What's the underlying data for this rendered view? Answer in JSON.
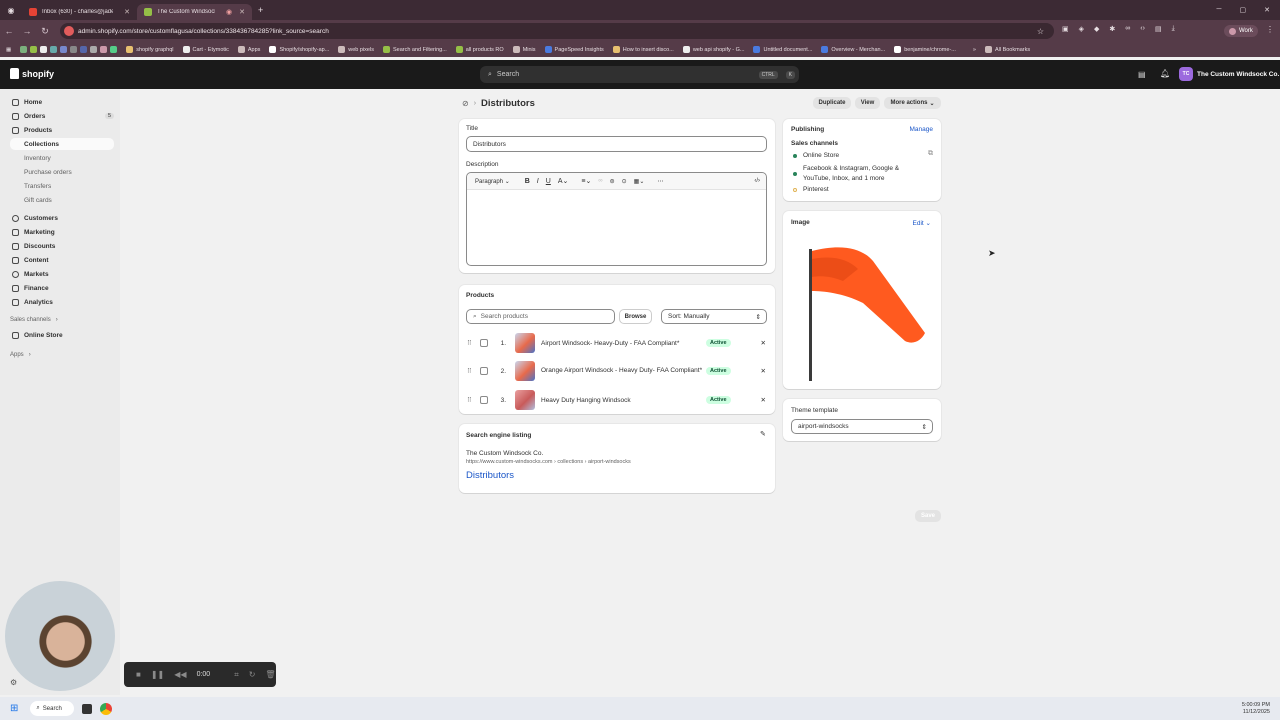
{
  "browser": {
    "tabs": [
      {
        "title": "Inbox (630) - charles@jadepur…",
        "active": false
      },
      {
        "title": "The Custom Windsock Co.",
        "active": true
      }
    ],
    "url": "admin.shopify.com/store/customflagusa/collections/338436784285?link_source=search",
    "profile": "Work",
    "bookmarks": [
      "shopify graphql",
      "Cart - Etymotic",
      "Apps",
      "Shopify/shopify-ap...",
      "web pixels",
      "Search and Filtering...",
      "all products RO",
      "Minis",
      "PageSpeed Insights",
      "How to insert disco...",
      "web api shopify - G...",
      "Untitled document...",
      "Overview - Merchan...",
      "benjamine/chrome-..."
    ],
    "all_bookmarks": "All Bookmarks"
  },
  "topbar": {
    "logo": "shopify",
    "search_placeholder": "Search",
    "shortcut_ctrl": "CTRL",
    "shortcut_key": "K",
    "store_initials": "TC",
    "store_name": "The Custom Windsock Co."
  },
  "sidebar": {
    "home": "Home",
    "orders": "Orders",
    "orders_count": "5",
    "products": "Products",
    "collections": "Collections",
    "inventory": "Inventory",
    "purchase_orders": "Purchase orders",
    "transfers": "Transfers",
    "gift_cards": "Gift cards",
    "customers": "Customers",
    "marketing": "Marketing",
    "discounts": "Discounts",
    "content": "Content",
    "markets": "Markets",
    "finance": "Finance",
    "analytics": "Analytics",
    "sales_channels": "Sales channels",
    "online_store": "Online Store",
    "apps": "Apps"
  },
  "page": {
    "title": "Distributors",
    "duplicate": "Duplicate",
    "view": "View",
    "more_actions": "More actions",
    "save": "Save"
  },
  "details": {
    "title_label": "Title",
    "title_value": "Distributors",
    "description_label": "Description",
    "format": "Paragraph"
  },
  "products": {
    "heading": "Products",
    "search_placeholder": "Search products",
    "browse": "Browse",
    "sort": "Sort: Manually",
    "items": [
      {
        "num": "1.",
        "name": "Airport Windsock- Heavy-Duty - FAA Compliant*",
        "status": "Active"
      },
      {
        "num": "2.",
        "name": "Orange Airport Windsock - Heavy Duty- FAA Compliant*",
        "status": "Active"
      },
      {
        "num": "3.",
        "name": "Heavy Duty Hanging Windsock",
        "status": "Active"
      }
    ]
  },
  "seo": {
    "heading": "Search engine listing",
    "store": "The Custom Windsock Co.",
    "url": "https://www.custom-windsocks.com › collections › airport-windsocks",
    "title": "Distributors"
  },
  "publishing": {
    "heading": "Publishing",
    "manage": "Manage",
    "sales_channels": "Sales channels",
    "channels": [
      {
        "name": "Online Store",
        "color": "#29845a"
      },
      {
        "name": "Facebook & Instagram, Google & YouTube, Inbox, and 1 more",
        "color": "#29845a"
      },
      {
        "name": "Pinterest",
        "color": "#e0b252"
      }
    ]
  },
  "image_card": {
    "heading": "Image",
    "edit": "Edit"
  },
  "theme": {
    "heading": "Theme template",
    "value": "airport-windsocks"
  },
  "recorder": {
    "time": "0:00"
  },
  "taskbar": {
    "search": "Search",
    "time": "5:00:09 PM",
    "date": "11/12/2025"
  }
}
